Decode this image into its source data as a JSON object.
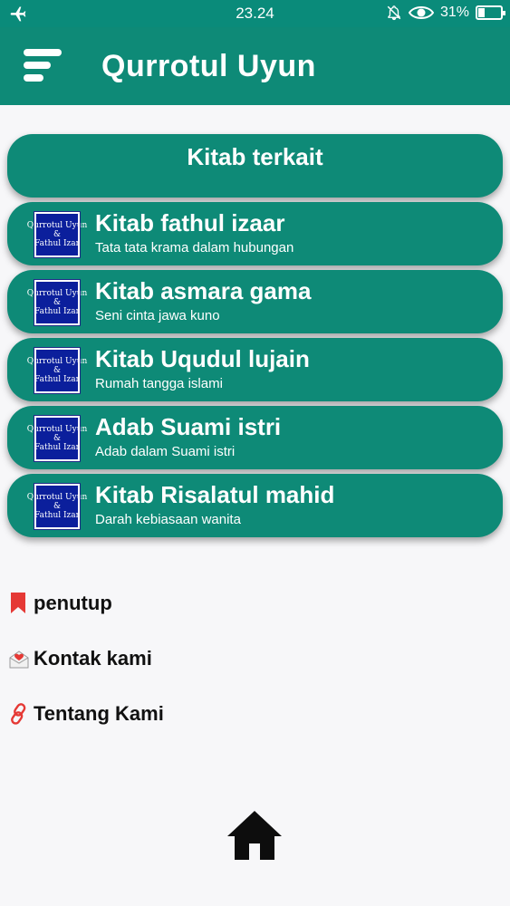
{
  "status": {
    "time": "23.24",
    "battery": "31%",
    "battery_level": 0.31
  },
  "app": {
    "title": "Qurrotul Uyun"
  },
  "section_header": "Kitab terkait",
  "thumb_text": {
    "line1": "Qurrotul Uyun",
    "line2": "&",
    "line3": "Fathul Izar"
  },
  "items": [
    {
      "title": "Kitab fathul izaar",
      "subtitle": "Tata tata krama dalam hubungan"
    },
    {
      "title": "Kitab asmara gama",
      "subtitle": "Seni cinta jawa kuno"
    },
    {
      "title": "Kitab Uqudul lujain",
      "subtitle": "Rumah tangga islami"
    },
    {
      "title": "Adab Suami istri",
      "subtitle": "Adab dalam Suami istri"
    },
    {
      "title": "Kitab Risalatul mahid",
      "subtitle": "Darah kebiasaan wanita"
    }
  ],
  "menu": [
    {
      "label": "penutup",
      "icon": "bookmark-icon"
    },
    {
      "label": "Kontak kami",
      "icon": "mail-icon"
    },
    {
      "label": "Tentang Kami",
      "icon": "link-icon"
    }
  ],
  "colors": {
    "primary": "#0e8a77",
    "statusbar": "#0a8b7a",
    "thumb": "#0b1f9c",
    "bookmark": "#e53935"
  }
}
